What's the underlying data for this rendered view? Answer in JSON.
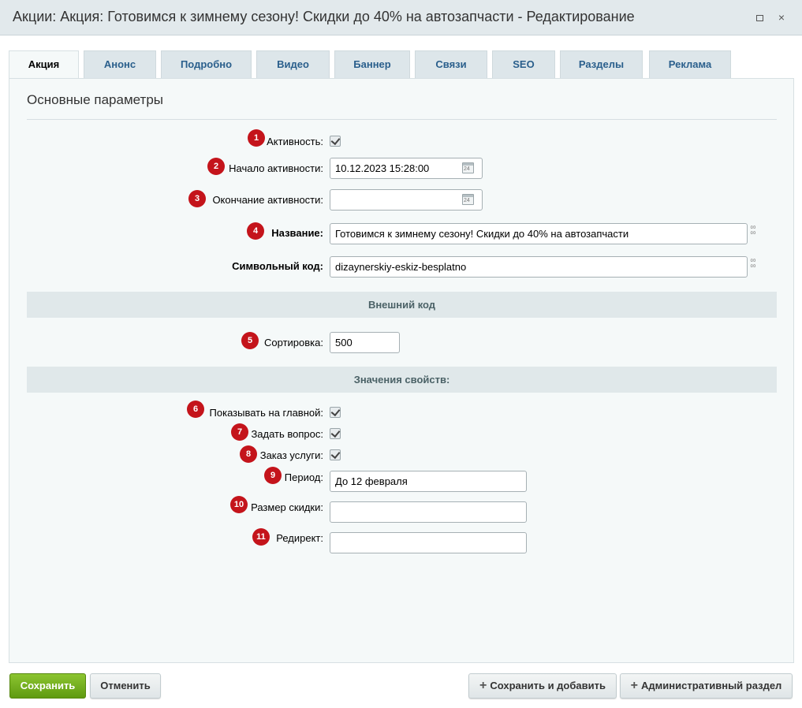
{
  "window": {
    "title": "Акции: Акция: Готовимся к зимнему сезону! Скидки до 40% на автозапчасти - Редактирование",
    "maximize_label": "",
    "close_label": "×"
  },
  "tabs": [
    {
      "label": "Акция",
      "active": true
    },
    {
      "label": "Анонс"
    },
    {
      "label": "Подробно"
    },
    {
      "label": "Видео"
    },
    {
      "label": "Баннер"
    },
    {
      "label": "Связи"
    },
    {
      "label": "SEO"
    },
    {
      "label": "Разделы"
    },
    {
      "label": "Реклама"
    }
  ],
  "section": {
    "title": "Основные параметры"
  },
  "fields": {
    "active": {
      "badge": "1",
      "label": "Активность:",
      "checked": true
    },
    "active_from": {
      "badge": "2",
      "label": "Начало активности:",
      "value": "10.12.2023 15:28:00"
    },
    "active_to": {
      "badge": "3",
      "label": "Окончание активности:",
      "value": ""
    },
    "name": {
      "badge": "4",
      "label": "Название:",
      "value": "Готовимся к зимнему сезону! Скидки до 40% на автозапчасти"
    },
    "code": {
      "label": "Символьный код:",
      "value": "dizaynerskiy-eskiz-besplatno"
    },
    "sort": {
      "badge": "5",
      "label": "Сортировка:",
      "value": "500"
    }
  },
  "bands": {
    "external_code": "Внешний код",
    "properties": "Значения свойств:"
  },
  "properties": {
    "show_main": {
      "badge": "6",
      "label": "Показывать на главной:",
      "checked": true
    },
    "ask_question": {
      "badge": "7",
      "label": "Задать вопрос:",
      "checked": true
    },
    "order_service": {
      "badge": "8",
      "label": "Заказ услуги:",
      "checked": true
    },
    "period": {
      "badge": "9",
      "label": "Период:",
      "value": "До 12 февраля"
    },
    "discount": {
      "badge": "10",
      "label": "Размер скидки:",
      "value": ""
    },
    "redirect": {
      "badge": "11",
      "label": "Редирект:",
      "value": ""
    }
  },
  "calendar_icon_text": "24",
  "buttons": {
    "save": "Сохранить",
    "cancel": "Отменить",
    "save_add": "Сохранить и добавить",
    "admin": "Административный раздел"
  },
  "colors": {
    "badge": "#c4141b",
    "save_button": "#6aa616",
    "tab_text": "#2a5f8c"
  }
}
